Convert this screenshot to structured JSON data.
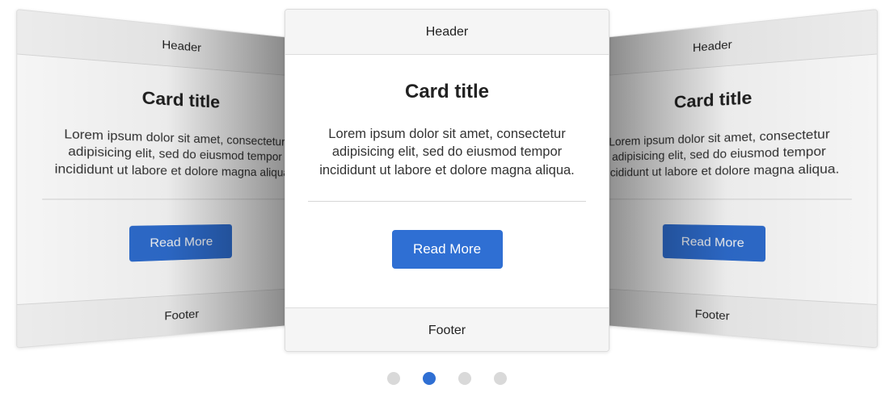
{
  "carousel": {
    "cards": [
      {
        "header": "Header",
        "title": "Card title",
        "text": "Lorem ipsum dolor sit amet, consectetur adipisicing elit, sed do eiusmod tempor incididunt ut labore et dolore magna aliqua.",
        "button_label": "Read More",
        "footer": "Footer"
      },
      {
        "header": "Header",
        "title": "Card title",
        "text": "Lorem ipsum dolor sit amet, consectetur adipisicing elit, sed do eiusmod tempor incididunt ut labore et dolore magna aliqua.",
        "button_label": "Read More",
        "footer": "Footer"
      },
      {
        "header": "Header",
        "title": "Card title",
        "text": "Lorem ipsum dolor sit amet, consectetur adipisicing elit, sed do eiusmod tempor incididunt ut labore et dolore magna aliqua.",
        "button_label": "Read More",
        "footer": "Footer"
      }
    ],
    "active_card_index": 1,
    "pagination": {
      "dot_count": 4,
      "active_dot_index": 1
    },
    "colors": {
      "accent": "#2f6fd3",
      "inactive_dot": "#d9d9d9",
      "header_footer_bg": "#f5f5f5"
    }
  }
}
